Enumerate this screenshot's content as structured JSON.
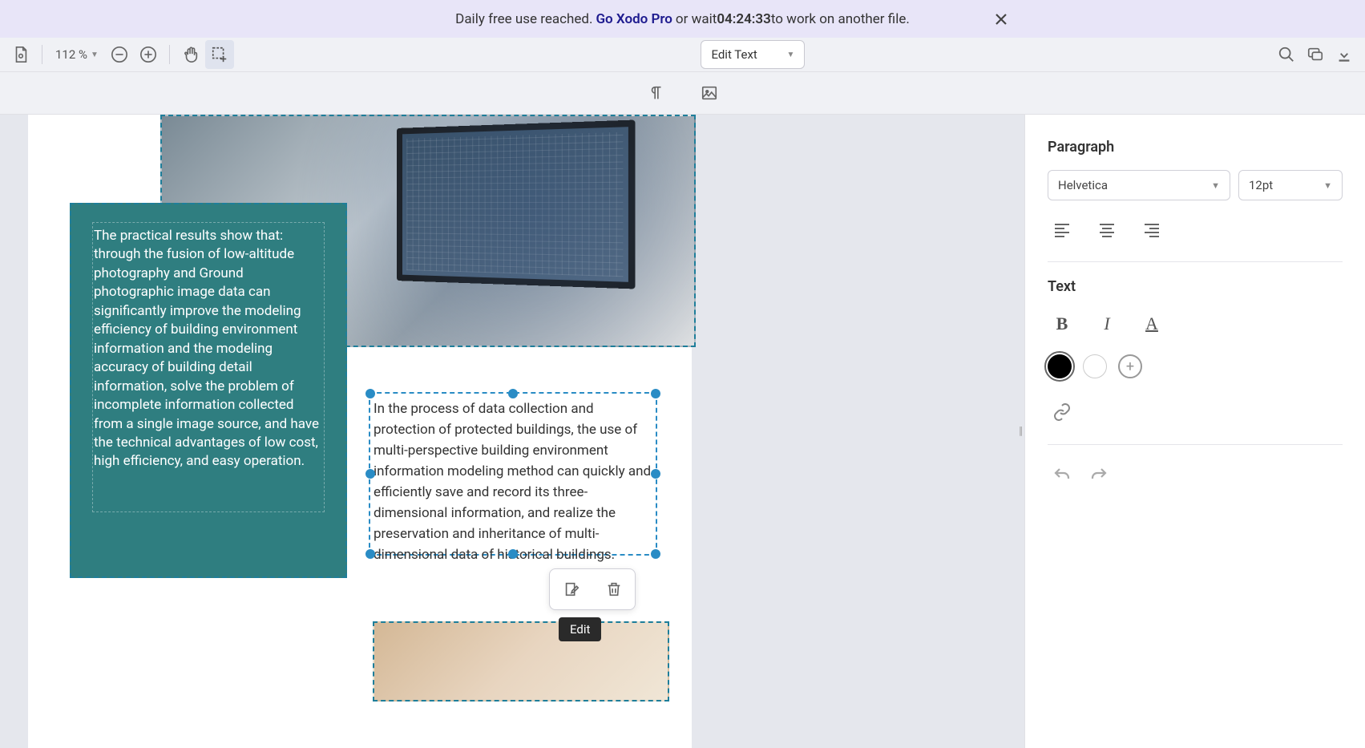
{
  "banner": {
    "prefix": "Daily free use reached. ",
    "cta": "Go Xodo Pro",
    "middle": " or wait ",
    "timer": "04:24:33",
    "suffix": " to work on another file."
  },
  "toolbar": {
    "zoom": "112 %",
    "mode": "Edit Text"
  },
  "document": {
    "teal_text": "The practical results show that: through the fusion of low-altitude photography and Ground photographic image data can significantly improve the modeling efficiency of building environment information and the modeling accuracy of building detail information, solve the problem of incomplete information collected from a single image source, and have the technical advantages of low cost, high efficiency, and easy operation.",
    "selected_text": "In the process of data collection and protection of protected buildings, the use of multi-perspective building environment information modeling method can quickly and efficiently save and record its three-dimensional information, and realize the preservation and inheritance of multi-dimensional data of historical buildings."
  },
  "float_tooltip": "Edit",
  "panel": {
    "section_paragraph": "Paragraph",
    "section_text": "Text",
    "font_family": "Helvetica",
    "font_size": "12pt",
    "colors": {
      "active": "#000000"
    }
  }
}
